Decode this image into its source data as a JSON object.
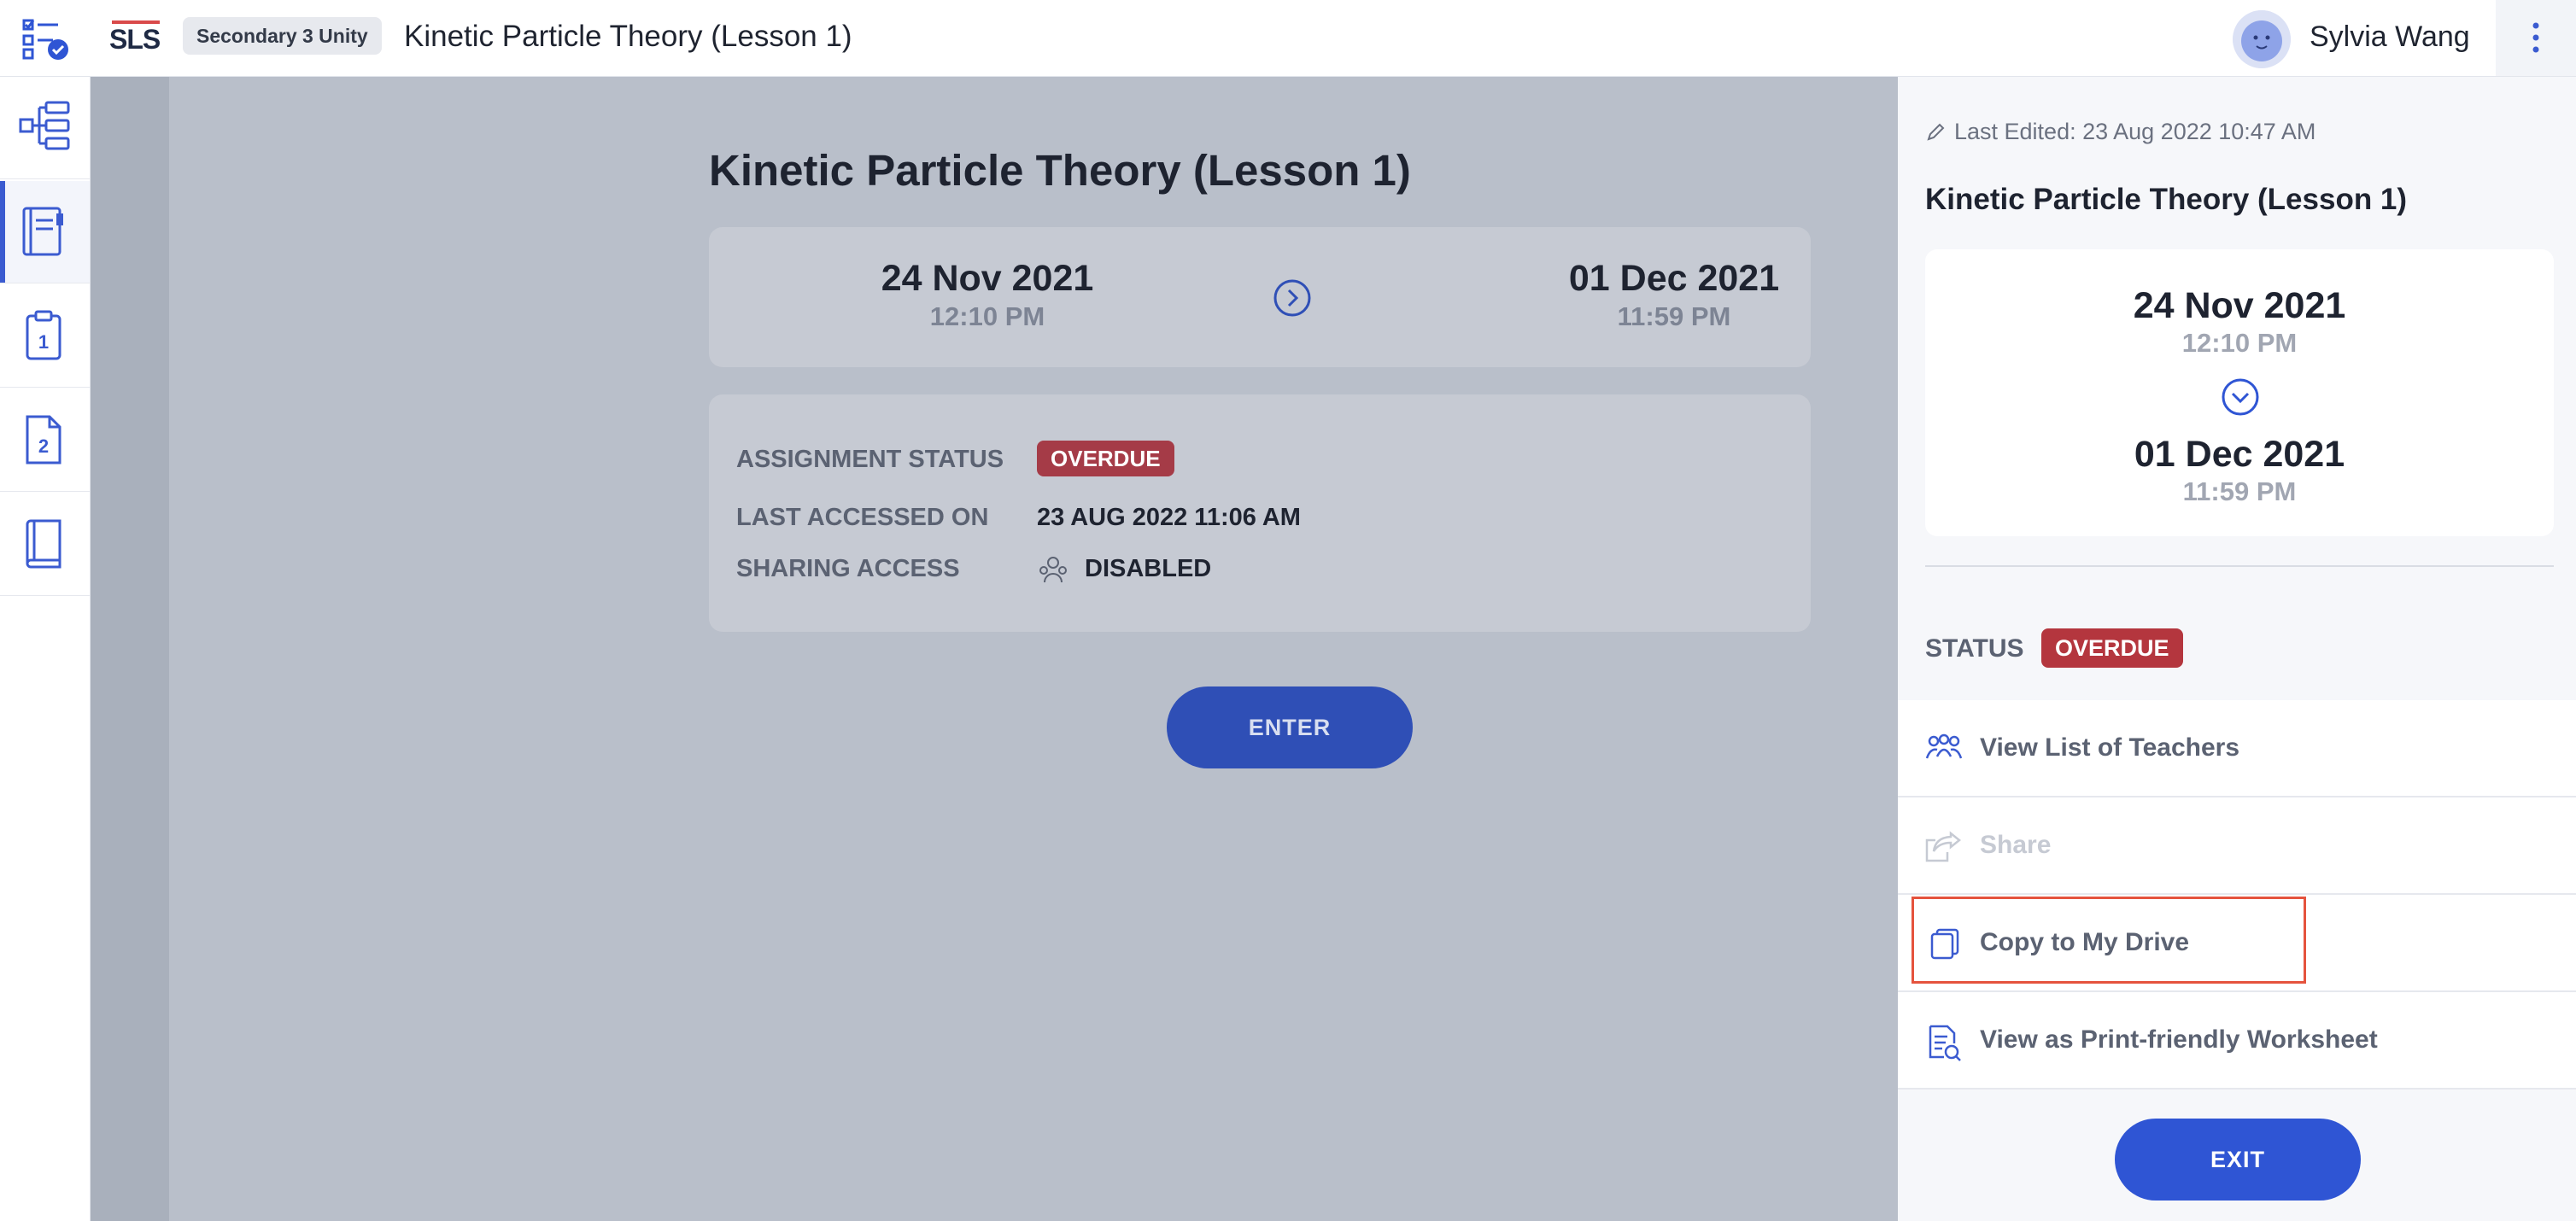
{
  "header": {
    "logo_text": "SLS",
    "class_chip": "Secondary 3 Unity",
    "lesson_title": "Kinetic Particle Theory (Lesson 1)",
    "user_name": "Sylvia Wang",
    "icons": [
      "task-list-icon",
      "more-vertical-icon",
      "avatar"
    ]
  },
  "sidebar": {
    "items": [
      {
        "name": "lesson-map",
        "icon": "lesson-map-icon",
        "active": false
      },
      {
        "name": "lesson-notebook",
        "icon": "notebook-icon",
        "active": true
      },
      {
        "name": "activity-1",
        "icon": "clipboard-1-icon",
        "label": "1",
        "active": false
      },
      {
        "name": "activity-2",
        "icon": "document-2-icon",
        "label": "2",
        "active": false
      },
      {
        "name": "book",
        "icon": "book-icon",
        "active": false
      }
    ]
  },
  "main": {
    "title": "Kinetic Particle Theory (Lesson 1)",
    "start": {
      "date": "24 Nov 2021",
      "time": "12:10 PM"
    },
    "end": {
      "date": "01 Dec 2021",
      "time": "11:59 PM"
    },
    "info": {
      "status_label": "ASSIGNMENT STATUS",
      "status_value": "OVERDUE",
      "accessed_label": "LAST ACCESSED ON",
      "accessed_value": "23 AUG 2022 11:06 AM",
      "sharing_label": "SHARING ACCESS",
      "sharing_value": "DISABLED"
    },
    "enter_label": "ENTER"
  },
  "panel": {
    "last_edited": "Last Edited: 23 Aug 2022 10:47 AM",
    "title": "Kinetic Particle Theory (Lesson 1)",
    "start": {
      "date": "24 Nov 2021",
      "time": "12:10 PM"
    },
    "end": {
      "date": "01 Dec 2021",
      "time": "11:59 PM"
    },
    "status_label": "STATUS",
    "status_value": "OVERDUE",
    "menu": [
      {
        "label": "View List of Teachers",
        "icon": "teachers-icon",
        "enabled": true
      },
      {
        "label": "Share",
        "icon": "share-icon",
        "enabled": false
      },
      {
        "label": "Copy to My Drive",
        "icon": "copy-icon",
        "enabled": true,
        "highlighted": true
      },
      {
        "label": "View as Print-friendly Worksheet",
        "icon": "worksheet-icon",
        "enabled": true
      }
    ],
    "exit_label": "EXIT"
  },
  "colors": {
    "accent": "#2f55d4",
    "overdue": "#b4363e",
    "highlight": "#e5533d",
    "overlay": "#b9bfca"
  }
}
